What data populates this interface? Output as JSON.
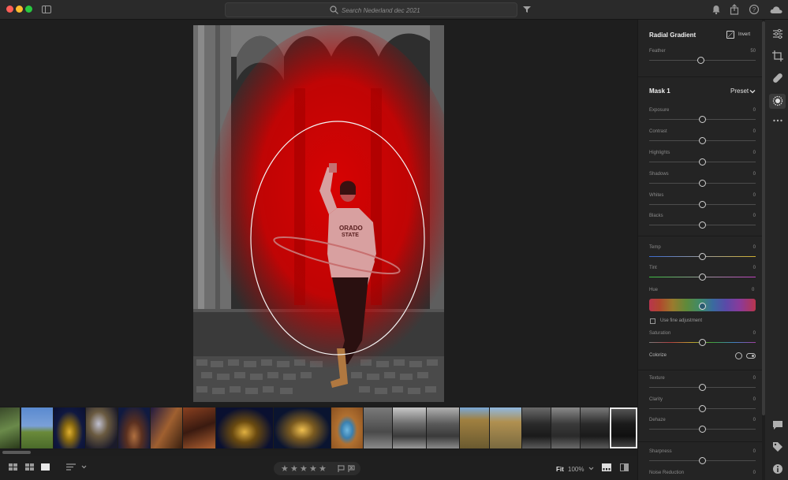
{
  "titlebar": {
    "search_placeholder": "Search Nederland dec 2021"
  },
  "panel": {
    "title": "Radial Gradient",
    "invert_label": "Invert",
    "feather": {
      "label": "Feather",
      "value": "50"
    },
    "mask_title": "Mask 1",
    "preset_label": "Preset",
    "sliders": [
      {
        "label": "Exposure",
        "value": "0",
        "level": 0
      },
      {
        "label": "Contrast",
        "value": "0",
        "level": 0
      },
      {
        "label": "Highlights",
        "value": "0",
        "level": 0
      },
      {
        "label": "Shadows",
        "value": "0",
        "level": 0
      },
      {
        "label": "Whites",
        "value": "0",
        "level": 0
      },
      {
        "label": "Blacks",
        "value": "0",
        "level": 0
      }
    ],
    "color_sliders": [
      {
        "label": "Temp",
        "value": "0"
      },
      {
        "label": "Tint",
        "value": "0"
      }
    ],
    "hue": {
      "label": "Hue",
      "value": "0"
    },
    "fine_adjust_label": "Use fine adjustment",
    "saturation": {
      "label": "Saturation",
      "value": "0"
    },
    "colorize_label": "Colorize",
    "effects": [
      {
        "label": "Texture",
        "value": "0"
      },
      {
        "label": "Clarity",
        "value": "0"
      },
      {
        "label": "Dehaze",
        "value": "0"
      }
    ],
    "sharpness": {
      "label": "Sharpness",
      "value": "0"
    },
    "noise_reduction": {
      "label": "Noise Reduction",
      "value": "0"
    }
  },
  "bottombar": {
    "fit_label": "Fit",
    "zoom_label": "100%",
    "stars": [
      "★",
      "★",
      "★",
      "★",
      "★"
    ]
  },
  "colors": {
    "mask_overlay": "#e00000",
    "panel_bg": "#242424",
    "app_bg": "#1e1e1e"
  },
  "icons": {
    "titlebar": [
      "sidebar-toggle-icon",
      "search-icon",
      "filter-icon",
      "bell-icon",
      "share-icon",
      "help-icon",
      "cloud-icon"
    ],
    "strip": [
      "edit-sliders-icon",
      "crop-icon",
      "healing-icon",
      "masking-icon",
      "more-icon",
      "comment-icon",
      "tag-icon",
      "info-icon"
    ]
  }
}
